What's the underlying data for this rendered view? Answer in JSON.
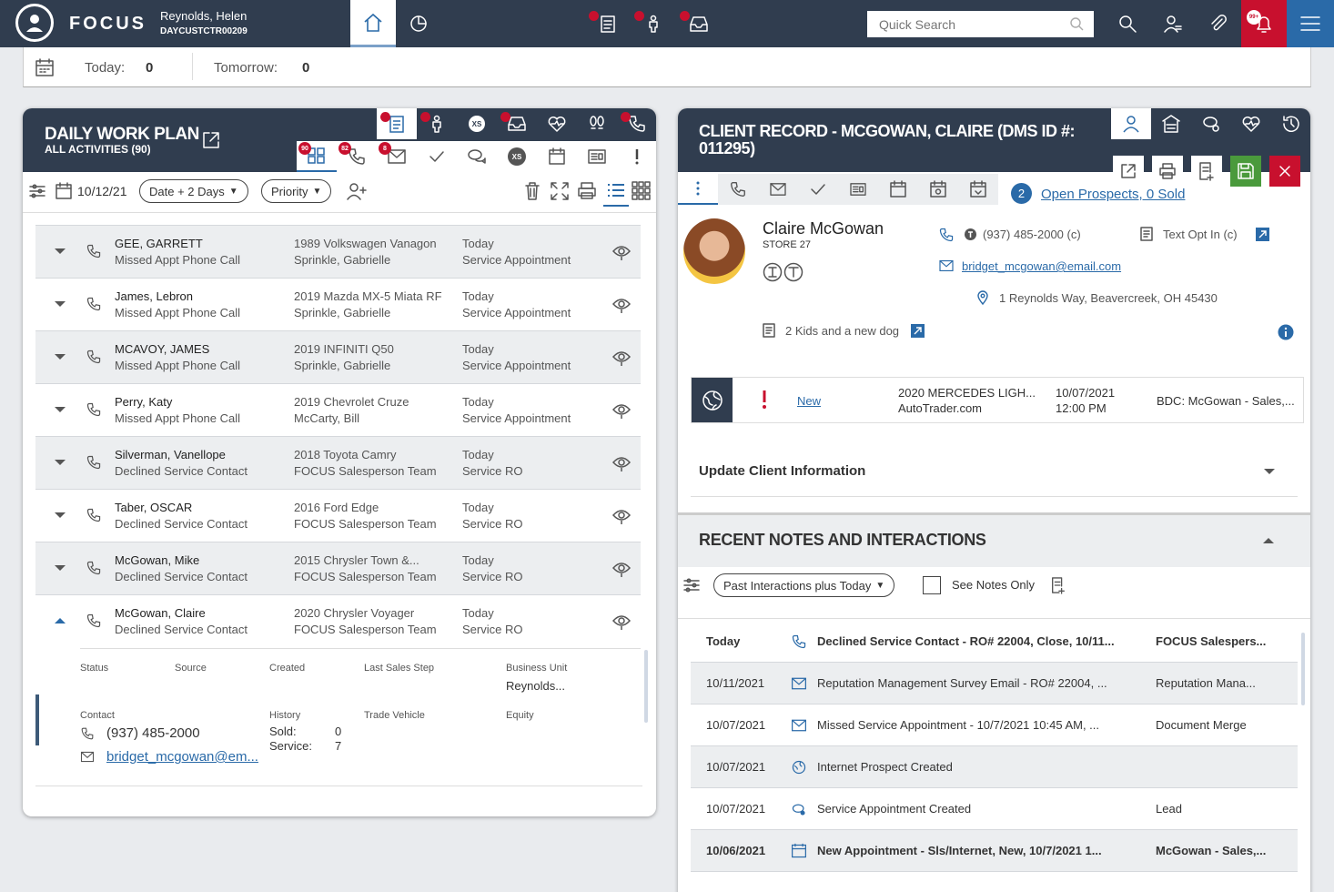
{
  "app": {
    "logo": "FOCUS",
    "user_name": "Reynolds, Helen",
    "user_id": "DAYCUSTCTR00209",
    "search_placeholder": "Quick Search",
    "alert_badge": "99+"
  },
  "today_bar": {
    "today_label": "Today:",
    "today_count": "0",
    "tomorrow_label": "Tomorrow:",
    "tomorrow_count": "0"
  },
  "dwp": {
    "title": "DAILY WORK PLAN",
    "subtitle": "ALL ACTIVITIES (90)",
    "badges": {
      "all": "90",
      "calls": "82",
      "emails": "8"
    },
    "xs": "XS",
    "date": "10/12/21",
    "range": "Date + 2 Days",
    "sort": "Priority",
    "rows": [
      {
        "name": "GEE, GARRETT",
        "activity": "Missed Appt Phone Call",
        "vehicle": "1989 Volkswagen Vanagon",
        "person": "Sprinkle, Gabrielle",
        "day": "Today",
        "type": "Service Appointment"
      },
      {
        "name": "James, Lebron",
        "activity": "Missed Appt Phone Call",
        "vehicle": "2019 Mazda MX-5 Miata RF",
        "person": "Sprinkle, Gabrielle",
        "day": "Today",
        "type": "Service Appointment"
      },
      {
        "name": "MCAVOY, JAMES",
        "activity": "Missed Appt Phone Call",
        "vehicle": "2019 INFINITI Q50",
        "person": "Sprinkle, Gabrielle",
        "day": "Today",
        "type": "Service Appointment"
      },
      {
        "name": "Perry, Katy",
        "activity": "Missed Appt Phone Call",
        "vehicle": "2019 Chevrolet Cruze",
        "person": "McCarty, Bill",
        "day": "Today",
        "type": "Service Appointment"
      },
      {
        "name": "Silverman, Vanellope",
        "activity": "Declined Service Contact",
        "vehicle": "2018 Toyota Camry",
        "person": "FOCUS Salesperson Team",
        "day": "Today",
        "type": "Service RO"
      },
      {
        "name": "Taber, OSCAR",
        "activity": "Declined Service Contact",
        "vehicle": "2016 Ford Edge",
        "person": "FOCUS Salesperson Team",
        "day": "Today",
        "type": "Service RO"
      },
      {
        "name": "McGowan, Mike",
        "activity": "Declined Service Contact",
        "vehicle": "2015 Chrysler Town &...",
        "person": "FOCUS Salesperson Team",
        "day": "Today",
        "type": "Service RO"
      },
      {
        "name": "McGowan, Claire",
        "activity": "Declined Service Contact",
        "vehicle": "2020 Chrysler Voyager",
        "person": "FOCUS Salesperson Team",
        "day": "Today",
        "type": "Service RO"
      }
    ],
    "detail": {
      "status_label": "Status",
      "source_label": "Source",
      "created_label": "Created",
      "last_step_label": "Last Sales Step",
      "bu_label": "Business Unit",
      "bu_value": "Reynolds...",
      "contact_label": "Contact",
      "phone": "(937) 485-2000",
      "email": "bridget_mcgowan@em...",
      "history_label": "History",
      "sold_label": "Sold:",
      "sold": "0",
      "service_label": "Service:",
      "service": "7",
      "trade_label": "Trade Vehicle",
      "equity_label": "Equity"
    }
  },
  "cr": {
    "title": "CLIENT RECORD - MCGOWAN, CLAIRE (DMS ID #: 011295)",
    "prospects_count": "2",
    "prospects_link": "Open Prospects, 0 Sold",
    "client_name": "Claire McGowan",
    "store": "STORE 27",
    "phone": "(937) 485-2000 (c)",
    "text_opt": "Text Opt In (c)",
    "email": "bridget_mcgowan@email.com",
    "address": "1 Reynolds Way, Beavercreek, OH 45430",
    "note": "2 Kids and a new dog",
    "prospect": {
      "status": "New",
      "vehicle": "2020 MERCEDES LIGH...",
      "source": "AutoTrader.com",
      "date": "10/07/2021",
      "time": "12:00 PM",
      "assigned": "BDC: McGowan - Sales,..."
    },
    "update_label": "Update Client Information",
    "notes_title": "RECENT NOTES AND INTERACTIONS",
    "notes_filter": "Past Interactions plus Today",
    "see_notes": "See Notes Only",
    "notes": [
      {
        "date": "Today",
        "desc": "Declined Service Contact - RO# 22004, Close, 10/11...",
        "who": "FOCUS Salespers...",
        "bold": true
      },
      {
        "date": "10/11/2021",
        "desc": "Reputation Management Survey Email - RO# 22004, ...",
        "who": "Reputation Mana...",
        "bold": false
      },
      {
        "date": "10/07/2021",
        "desc": "Missed Service Appointment - 10/7/2021 10:45 AM, ...",
        "who": "Document Merge",
        "bold": false
      },
      {
        "date": "10/07/2021",
        "desc": "Internet Prospect Created",
        "who": "",
        "bold": false
      },
      {
        "date": "10/07/2021",
        "desc": "Service Appointment Created",
        "who": "Lead",
        "bold": false
      },
      {
        "date": "10/06/2021",
        "desc": "New Appointment - Sls/Internet, New, 10/7/2021 1...",
        "who": "McGowan - Sales,...",
        "bold": true
      }
    ]
  },
  "colors": {
    "nav": "#303d4f",
    "accent": "#2a6aa8",
    "alert": "#c8102e",
    "save": "#4a9a3c"
  }
}
